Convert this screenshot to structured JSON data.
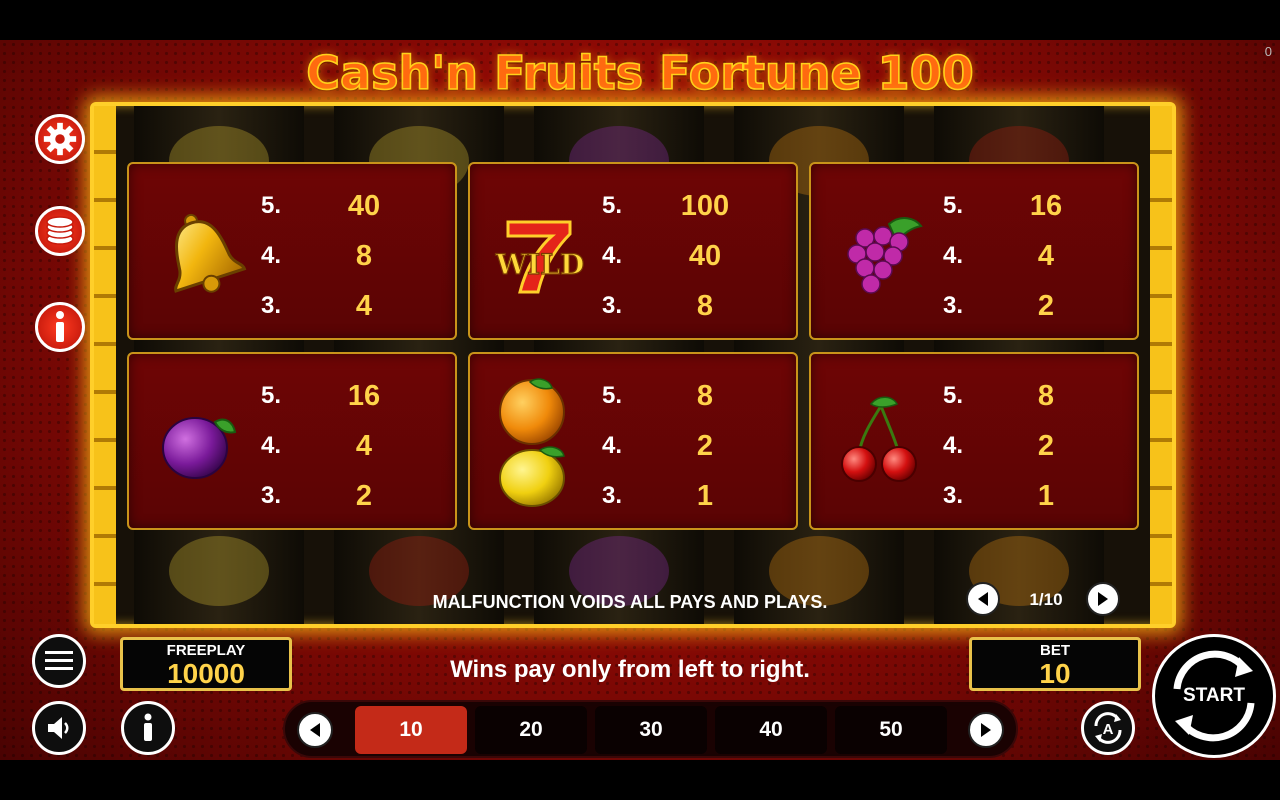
{
  "game": {
    "title": "Cash'n Fruits Fortune 100",
    "corner_counter": "0"
  },
  "colors": {
    "accent_gold": "#ffd34a",
    "frame_gold": "#ffcf2a",
    "background_red": "#9e0e06",
    "selected_bet": "#c42a18"
  },
  "paytable": {
    "cards": [
      {
        "symbol": "bell-icon",
        "rows": [
          {
            "count": "5.",
            "value": "40"
          },
          {
            "count": "4.",
            "value": "8"
          },
          {
            "count": "3.",
            "value": "4"
          }
        ]
      },
      {
        "symbol": "wild-seven-icon",
        "symbol_text": "WILD",
        "rows": [
          {
            "count": "5.",
            "value": "100"
          },
          {
            "count": "4.",
            "value": "40"
          },
          {
            "count": "3.",
            "value": "8"
          }
        ]
      },
      {
        "symbol": "grapes-icon",
        "rows": [
          {
            "count": "5.",
            "value": "16"
          },
          {
            "count": "4.",
            "value": "4"
          },
          {
            "count": "3.",
            "value": "2"
          }
        ]
      },
      {
        "symbol": "plum-icon",
        "rows": [
          {
            "count": "5.",
            "value": "16"
          },
          {
            "count": "4.",
            "value": "4"
          },
          {
            "count": "3.",
            "value": "2"
          }
        ]
      },
      {
        "symbol": "orange-lemon-icon",
        "rows": [
          {
            "count": "5.",
            "value": "8"
          },
          {
            "count": "4.",
            "value": "2"
          },
          {
            "count": "3.",
            "value": "1"
          }
        ]
      },
      {
        "symbol": "cherry-icon",
        "rows": [
          {
            "count": "5.",
            "value": "8"
          },
          {
            "count": "4.",
            "value": "2"
          },
          {
            "count": "3.",
            "value": "1"
          }
        ]
      }
    ],
    "malfunction_notice": "MALFUNCTION VOIDS ALL PAYS AND PLAYS.",
    "page_indicator": "1/10"
  },
  "controls": {
    "settings": "gear-icon",
    "coins": "coin-stack-icon",
    "info": "info-icon",
    "menu": "hamburger-icon",
    "sound": "speaker-icon",
    "info_small": "info-icon",
    "autoplay": "autoplay-icon"
  },
  "freeplay": {
    "label": "FREEPLAY",
    "value": "10000"
  },
  "bet": {
    "label": "BET",
    "value": "10"
  },
  "wins_note": "Wins pay only from left to right.",
  "bet_options": [
    "10",
    "20",
    "30",
    "40",
    "50"
  ],
  "selected_bet_index": 0,
  "start_label": "START"
}
